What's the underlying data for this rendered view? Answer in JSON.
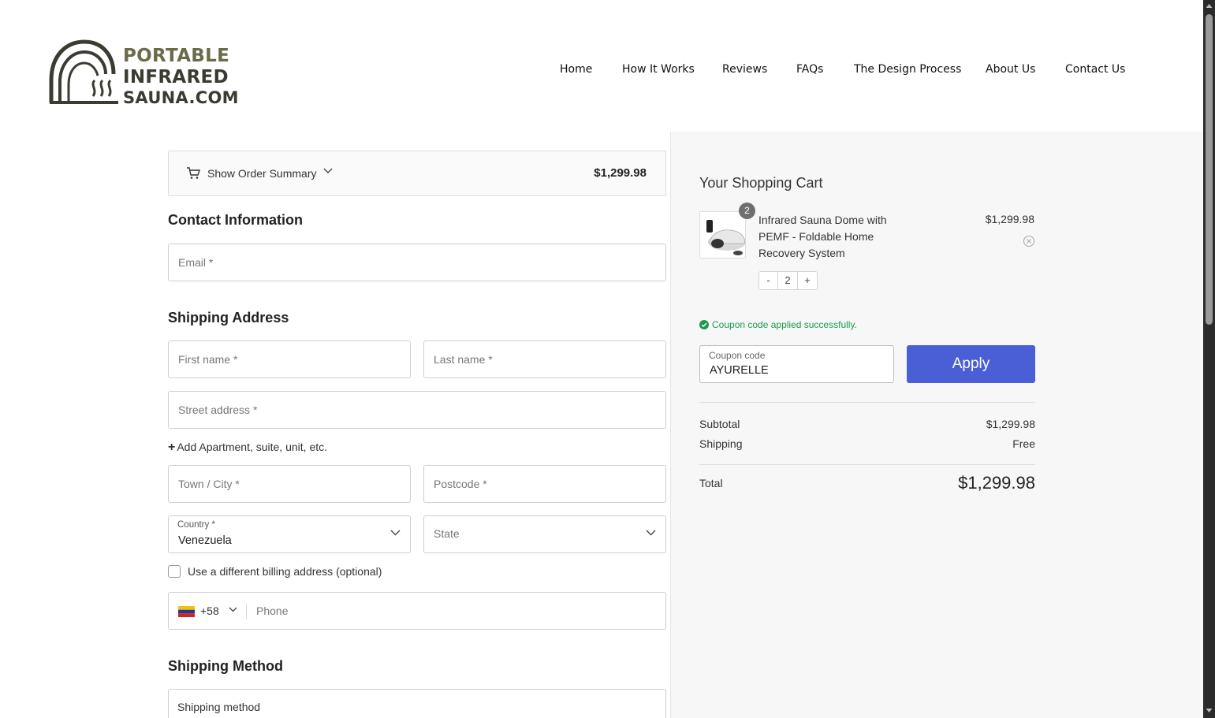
{
  "brand": {
    "line1": "PORTABLE",
    "line2": "INFRARED",
    "line3": "SAUNA.COM"
  },
  "nav": [
    "Home",
    "How It Works",
    "Reviews",
    "FAQs",
    "The Design Process",
    "About Us",
    "Contact Us"
  ],
  "summary_bar": {
    "label": "Show Order Summary",
    "amount": "$1,299.98"
  },
  "contact": {
    "title": "Contact Information",
    "email_placeholder": "Email *"
  },
  "shipping_address": {
    "title": "Shipping Address",
    "first_name": "First name *",
    "last_name": "Last name *",
    "street": "Street address *",
    "add_apartment": "Add Apartment, suite, unit, etc.",
    "city": "Town / City *",
    "postcode": "Postcode *",
    "country_label": "Country *",
    "country_value": "Venezuela",
    "state": "State",
    "billing_checkbox": "Use a different billing address (optional)",
    "phone_code": "+58",
    "phone_placeholder": "Phone"
  },
  "shipping_method": {
    "title": "Shipping Method",
    "label": "Shipping method"
  },
  "cart": {
    "title": "Your Shopping Cart",
    "item": {
      "name": "Infrared Sauna Dome with PEMF - Foldable Home Recovery System",
      "price": "$1,299.98",
      "quantity": "2",
      "badge": "2"
    },
    "stepper_minus": "-",
    "stepper_plus": "+",
    "coupon_message": "Coupon code applied successfully.",
    "coupon_label": "Coupon code",
    "coupon_value": "AYURELLE",
    "apply": "Apply",
    "subtotal_label": "Subtotal",
    "subtotal_value": "$1,299.98",
    "shipping_label": "Shipping",
    "shipping_value": "Free",
    "total_label": "Total",
    "total_value": "$1,299.98"
  },
  "colors": {
    "accent": "#4a5fd6",
    "success": "#1e9a4c",
    "brand_olive": "#6b6b4a"
  }
}
